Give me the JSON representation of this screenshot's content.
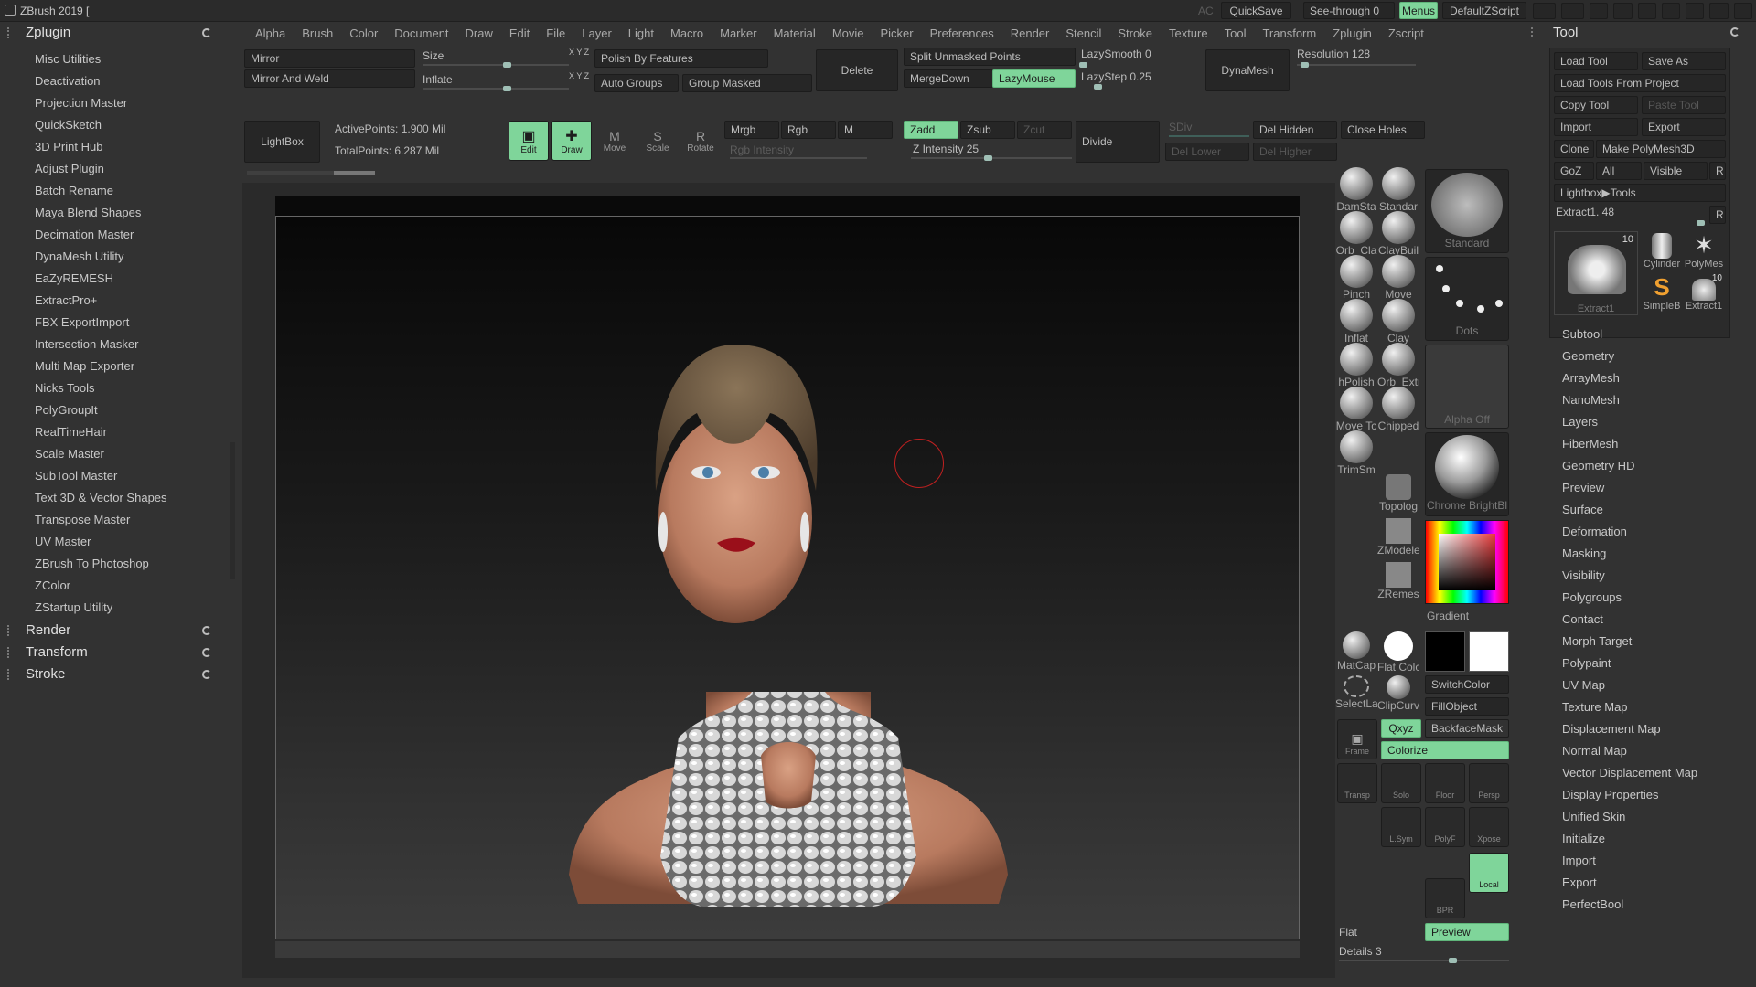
{
  "title": "ZBrush 2019 [",
  "titlebar": {
    "ac": "AC",
    "quicksave": "QuickSave",
    "see_through": "See-through  0",
    "menus": "Menus",
    "default_zscript": "DefaultZScript"
  },
  "menubar": [
    "Alpha",
    "Brush",
    "Color",
    "Document",
    "Draw",
    "Edit",
    "File",
    "Layer",
    "Light",
    "Macro",
    "Marker",
    "Material",
    "Movie",
    "Picker",
    "Preferences",
    "Render",
    "Stencil",
    "Stroke",
    "Texture",
    "Tool",
    "Transform",
    "Zplugin",
    "Zscript"
  ],
  "left_panel": {
    "zplugin_header": "Zplugin",
    "plugins": [
      "Misc Utilities",
      "Deactivation",
      "Projection Master",
      "QuickSketch",
      "3D Print Hub",
      "Adjust Plugin",
      "Batch Rename",
      "Maya Blend Shapes",
      "Decimation Master",
      "DynaMesh Utility",
      "EaZyREMESH",
      "ExtractPro+",
      "FBX ExportImport",
      "Intersection Masker",
      "Multi Map Exporter",
      "Nicks Tools",
      "PolyGroupIt",
      "RealTimeHair",
      "Scale Master",
      "SubTool Master",
      "Text 3D & Vector Shapes",
      "Transpose Master",
      "UV Master",
      "ZBrush To Photoshop",
      "ZColor",
      "ZStartup Utility"
    ],
    "render": "Render",
    "transform": "Transform",
    "stroke": "Stroke"
  },
  "toolbar": {
    "mirror": "Mirror",
    "mirror_weld": "Mirror And Weld",
    "size": "Size",
    "inflate": "Inflate",
    "xyz1": "X Y Z",
    "xyz2": "X Y Z",
    "polish_by_features": "Polish By Features",
    "auto_groups": "Auto Groups",
    "group_masked": "Group Masked",
    "delete": "Delete",
    "split_unmasked": "Split Unmasked Points",
    "merge_down": "MergeDown",
    "lazy_mouse": "LazyMouse",
    "lazy_smooth": "LazySmooth 0",
    "lazy_step": "LazyStep 0.25",
    "dynamesh": "DynaMesh",
    "resolution": "Resolution 128",
    "lightbox": "LightBox",
    "active_points": "ActivePoints: 1.900 Mil",
    "total_points": "TotalPoints: 6.287 Mil",
    "edit": "Edit",
    "draw": "Draw",
    "move": "Move",
    "scale": "Scale",
    "rotate": "Rotate",
    "mrgb": "Mrgb",
    "rgb": "Rgb",
    "m": "M",
    "zadd": "Zadd",
    "zsub": "Zsub",
    "zcut": "Zcut",
    "rgb_intensity": "Rgb Intensity",
    "z_intensity": "Z Intensity 25",
    "divide": "Divide",
    "sdiv": "SDiv",
    "del_lower": "Del Lower",
    "del_higher": "Del Higher",
    "del_hidden": "Del Hidden",
    "close_holes": "Close Holes"
  },
  "shelf": {
    "brushes": [
      "DamSta",
      "Standar",
      "Orb_Cla",
      "ClayBuil",
      "Pinch",
      "Move",
      "Inflat",
      "Clay",
      "hPolish",
      "Orb_Extr",
      "Move Tc",
      "Chipped",
      "TrimSm"
    ],
    "standard": "Standard",
    "dots": "Dots",
    "alpha_off": "Alpha Off",
    "material": "Chrome BrightBl",
    "topology": "Topolog",
    "zmodeler": "ZModele",
    "zremesher": "ZRemes",
    "gradient": "Gradient",
    "matcap": "MatCap",
    "flat_color": "Flat Colc",
    "switch_color": "SwitchColor",
    "fill_object": "FillObject",
    "select_lasso": "SelectLa",
    "clip_curve": "ClipCurv",
    "backface_mask": "BackfaceMask",
    "colorize": "Colorize",
    "qxyz": "Qxyz",
    "frame": "Frame",
    "transp": "Transp",
    "solo": "Solo",
    "floor": "Floor",
    "persp": "Persp",
    "lsym": "L.Sym",
    "polyf": "PolyF",
    "xpose": "Xpose",
    "local": "Local",
    "bpr": "BPR",
    "flat": "Flat",
    "preview": "Preview",
    "details": "Details 3"
  },
  "tool_panel": {
    "header": "Tool",
    "load_tool": "Load Tool",
    "save_as": "Save As",
    "load_from_project": "Load Tools From Project",
    "copy_tool": "Copy Tool",
    "paste_tool": "Paste Tool",
    "import": "Import",
    "export": "Export",
    "clone": "Clone",
    "make_polymesh": "Make PolyMesh3D",
    "goz": "GoZ",
    "all": "All",
    "visible": "Visible",
    "r": "R",
    "lightbox_tools": "Lightbox▶Tools",
    "extract_slider": "Extract1. 48",
    "thumb_count": "10",
    "thumb_count2": "10",
    "thumb_labels": [
      "Extract1",
      "Cylinder",
      "PolyMes",
      "SimpleB",
      "Extract1"
    ],
    "sections": [
      "Subtool",
      "Geometry",
      "ArrayMesh",
      "NanoMesh",
      "Layers",
      "FiberMesh",
      "Geometry HD",
      "Preview",
      "Surface",
      "Deformation",
      "Masking",
      "Visibility",
      "Polygroups",
      "Contact",
      "Morph Target",
      "Polypaint",
      "UV Map",
      "Texture Map",
      "Displacement Map",
      "Normal Map",
      "Vector Displacement Map",
      "Display Properties",
      "Unified Skin",
      "Initialize",
      "Import",
      "Export",
      "PerfectBool"
    ]
  },
  "colors": {
    "accent": "#7fd59a",
    "bg": "#323232",
    "panel": "#2b2b2b"
  }
}
